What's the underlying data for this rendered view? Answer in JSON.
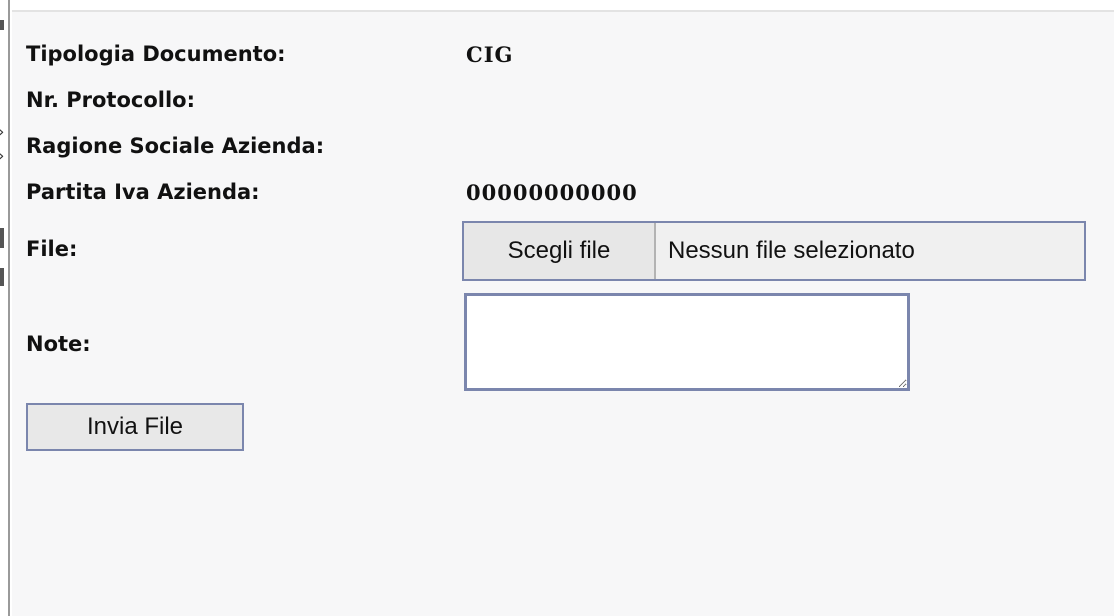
{
  "form": {
    "tipologia_documento": {
      "label": "Tipologia Documento:",
      "value": "CIG"
    },
    "nr_protocollo": {
      "label": "Nr. Protocollo:",
      "value": ""
    },
    "ragione_sociale": {
      "label": "Ragione Sociale Azienda:",
      "value": ""
    },
    "partita_iva": {
      "label": "Partita Iva Azienda:",
      "value": "00000000000"
    },
    "file": {
      "label": "File:",
      "button_label": "Scegli file",
      "status": "Nessun file selezionato"
    },
    "note": {
      "label": "Note:",
      "value": ""
    },
    "submit_label": "Invia File"
  },
  "colors": {
    "panel_background": "#f7f7f8",
    "input_border": "#7b86ad",
    "button_background": "#e8e8e8"
  }
}
